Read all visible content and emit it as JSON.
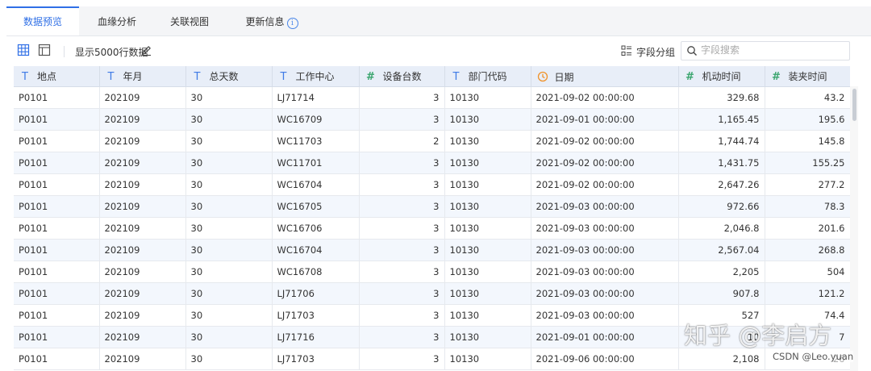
{
  "tabs": [
    {
      "label": "数据预览",
      "active": true
    },
    {
      "label": "血缘分析",
      "active": false
    },
    {
      "label": "关联视图",
      "active": false
    },
    {
      "label": "更新信息",
      "active": false
    }
  ],
  "toolbar": {
    "grid_view_icon": "table-grid-icon",
    "card_view_icon": "layout-panel-icon",
    "row_limit_text": "显示5000行数据",
    "edit_icon": "pencil-icon",
    "field_group_label": "字段分组",
    "search_placeholder": "字段搜索"
  },
  "columns": [
    {
      "label": "地点",
      "type": "text"
    },
    {
      "label": "年月",
      "type": "text"
    },
    {
      "label": "总天数",
      "type": "text"
    },
    {
      "label": "工作中心",
      "type": "text"
    },
    {
      "label": "设备台数",
      "type": "number"
    },
    {
      "label": "部门代码",
      "type": "text"
    },
    {
      "label": "日期",
      "type": "date"
    },
    {
      "label": "机动时间",
      "type": "number"
    },
    {
      "label": "装夹时间",
      "type": "number"
    }
  ],
  "rows": [
    [
      "P0101",
      "202109",
      "30",
      "LJ71714",
      "3",
      "10130",
      "2021-09-02 00:00:00",
      "329.68",
      "43.2"
    ],
    [
      "P0101",
      "202109",
      "30",
      "WC16709",
      "3",
      "10130",
      "2021-09-01 00:00:00",
      "1,165.45",
      "195.6"
    ],
    [
      "P0101",
      "202109",
      "30",
      "WC11703",
      "2",
      "10130",
      "2021-09-02 00:00:00",
      "1,744.74",
      "145.8"
    ],
    [
      "P0101",
      "202109",
      "30",
      "WC11701",
      "3",
      "10130",
      "2021-09-02 00:00:00",
      "1,431.75",
      "155.25"
    ],
    [
      "P0101",
      "202109",
      "30",
      "WC16704",
      "3",
      "10130",
      "2021-09-02 00:00:00",
      "2,647.26",
      "277.2"
    ],
    [
      "P0101",
      "202109",
      "30",
      "WC16705",
      "3",
      "10130",
      "2021-09-03 00:00:00",
      "972.66",
      "78.3"
    ],
    [
      "P0101",
      "202109",
      "30",
      "WC16706",
      "3",
      "10130",
      "2021-09-03 00:00:00",
      "2,046.8",
      "201.6"
    ],
    [
      "P0101",
      "202109",
      "30",
      "WC16704",
      "3",
      "10130",
      "2021-09-03 00:00:00",
      "2,567.04",
      "268.8"
    ],
    [
      "P0101",
      "202109",
      "30",
      "WC16708",
      "3",
      "10130",
      "2021-09-03 00:00:00",
      "2,205",
      "504"
    ],
    [
      "P0101",
      "202109",
      "30",
      "LJ71706",
      "3",
      "10130",
      "2021-09-03 00:00:00",
      "907.8",
      "121.2"
    ],
    [
      "P0101",
      "202109",
      "30",
      "LJ71703",
      "3",
      "10130",
      "2021-09-03 00:00:00",
      "527",
      "74.4"
    ],
    [
      "P0101",
      "202109",
      "30",
      "LJ71716",
      "3",
      "10130",
      "2021-09-01 00:00:00",
      "10",
      "7"
    ],
    [
      "P0101",
      "202109",
      "30",
      "LJ71703",
      "3",
      "10130",
      "2021-09-06 00:00:00",
      "2,108",
      "26"
    ]
  ],
  "watermarks": {
    "zhihu": "知乎 @李启方",
    "csdn": "CSDN @Leo.yuan"
  },
  "colors": {
    "accent": "#2f6fe6",
    "text_type_icon": "#3f7be6",
    "number_type_icon": "#3aa56e",
    "date_type_icon": "#f0932b",
    "header_bg": "#e8eef8",
    "alt_row_bg": "#f3f7fd"
  }
}
